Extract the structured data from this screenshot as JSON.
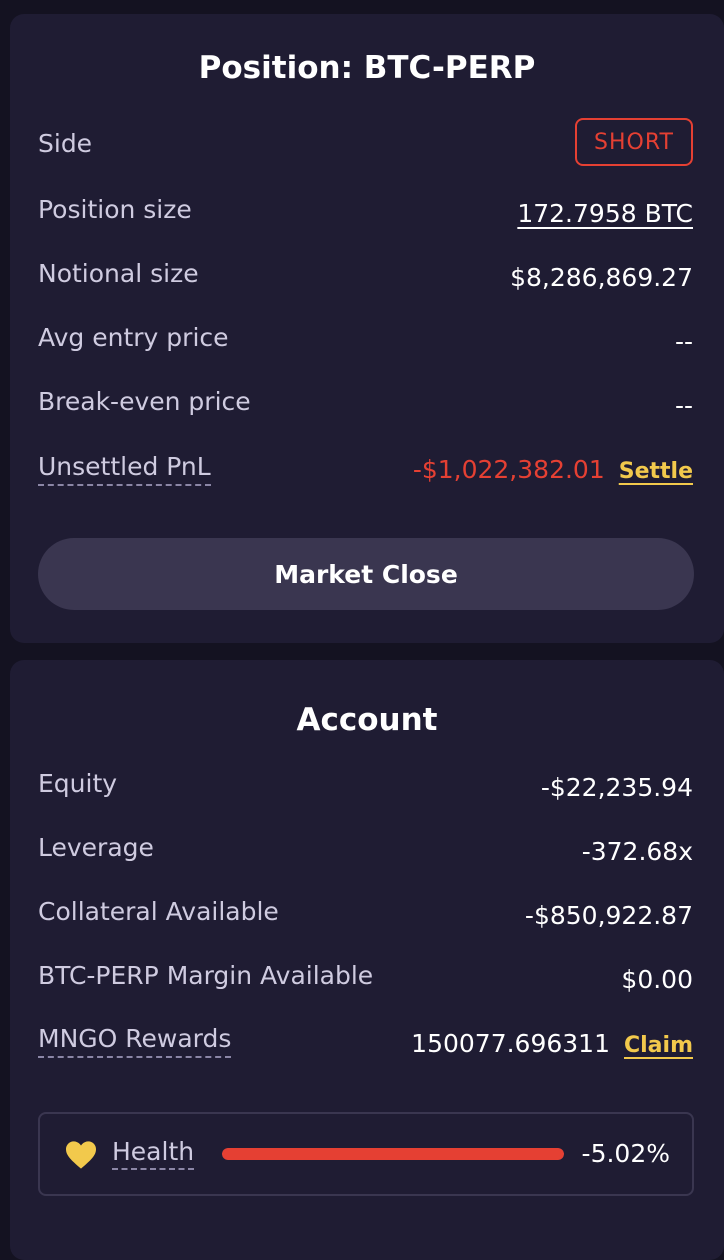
{
  "position": {
    "title": "Position: BTC-PERP",
    "side_label": "Side",
    "side_value": "SHORT",
    "size_label": "Position size",
    "size_value": "172.7958 BTC",
    "notional_label": "Notional size",
    "notional_value": "$8,286,869.27",
    "avg_entry_label": "Avg entry price",
    "avg_entry_value": "--",
    "break_even_label": "Break-even price",
    "break_even_value": "--",
    "pnl_label": "Unsettled PnL",
    "pnl_value": "-$1,022,382.01",
    "settle_label": "Settle",
    "market_close_label": "Market Close"
  },
  "account": {
    "title": "Account",
    "equity_label": "Equity",
    "equity_value": "-$22,235.94",
    "leverage_label": "Leverage",
    "leverage_value": "-372.68x",
    "collateral_label": "Collateral Available",
    "collateral_value": "-$850,922.87",
    "margin_label": "BTC-PERP Margin Available",
    "margin_value": "$0.00",
    "rewards_label": "MNGO Rewards",
    "rewards_value": "150077.696311",
    "claim_label": "Claim",
    "health_label": "Health",
    "health_value": "-5.02%",
    "health_icon": "heart-icon"
  },
  "colors": {
    "background": "#141221",
    "card": "#1f1c33",
    "negative": "#e54033",
    "accent_yellow": "#f2c94c"
  }
}
